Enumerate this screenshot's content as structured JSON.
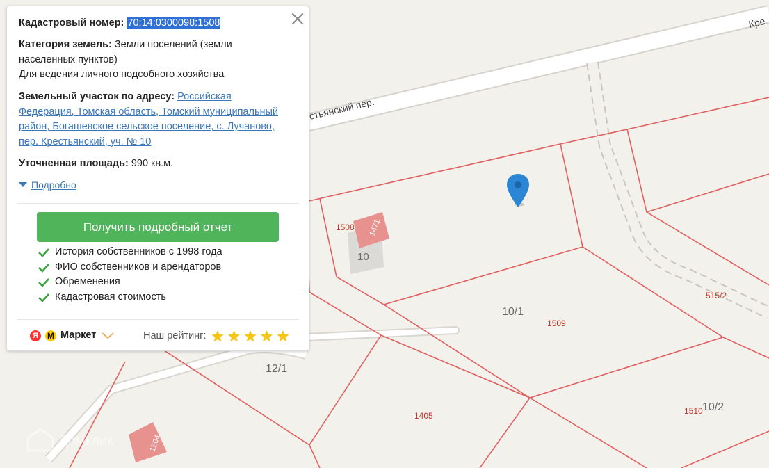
{
  "map": {
    "street_label_top": "Кре",
    "street_label_main": "стьянский пер.",
    "parcels": [
      {
        "label": "1508",
        "kind": "cad"
      },
      {
        "label": "1471",
        "kind": "building"
      },
      {
        "label": "10",
        "kind": "house"
      },
      {
        "label": "10/1",
        "kind": "house"
      },
      {
        "label": "1509",
        "kind": "cad"
      },
      {
        "label": "515/2",
        "kind": "cad"
      },
      {
        "label": "12/1",
        "kind": "house"
      },
      {
        "label": "1405",
        "kind": "cad"
      },
      {
        "label": "1510",
        "kind": "cad"
      },
      {
        "label": "10/2",
        "kind": "house"
      },
      {
        "label": "1504",
        "kind": "building"
      }
    ],
    "watermark": "Домклик",
    "parcel_line_color": "#e0605f",
    "road_color": "#ffffff",
    "background_color": "#f3f1ec",
    "pin_color": "#2c86d6",
    "pin_icon": "map-pin-icon"
  },
  "info": {
    "cad_label": "Кадастровый номер:",
    "cad_value": "70:14:0300098:1508",
    "category_label": "Категория земель:",
    "category_value_line1": "Земли поселений (земли",
    "category_value_line2": "населенных пунктов)",
    "usage": "Для ведения личного подсобного хозяйства",
    "address_label": "Земельный участок по адресу:",
    "address_line1": "Российская",
    "address_line2": "Федерация, Томская область, Томский муниципальный",
    "address_line3": "район, Богашевское сельское поселение, с. Лучаново,",
    "address_line4": "пер. Крестьянский, уч. № 10",
    "area_label": "Уточненная площадь:",
    "area_value": "990 кв.м.",
    "more_link": "Подробно",
    "close_icon": "close-icon"
  },
  "report": {
    "button": "Получить подробный отчет",
    "features": [
      "История собственников с 1998 года",
      "ФИО собственников и арендаторов",
      "Обременения",
      "Кадастровая стоимость"
    ],
    "button_color": "#4fb45a",
    "check_color": "#3aa33f"
  },
  "footer": {
    "ya_glyph": "Я",
    "market_glyph": "М",
    "market": "Маркет",
    "rating_label": "Наш рейтинг:",
    "stars": 5,
    "star_color": "#f5c518"
  }
}
